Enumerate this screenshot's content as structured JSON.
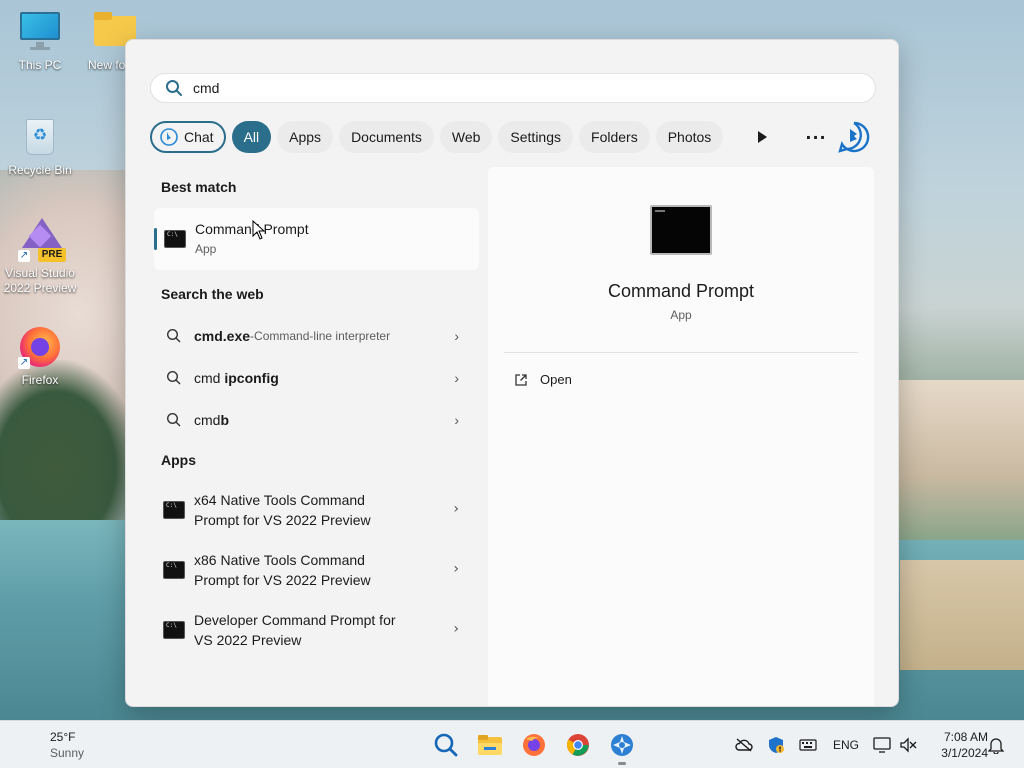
{
  "desktop": {
    "icons": [
      {
        "label": "This PC"
      },
      {
        "label": "New fo"
      },
      {
        "label": "Recycle Bin"
      },
      {
        "label": "Visual Studio 2022 Preview",
        "badge": "PRE"
      },
      {
        "label": "Firefox"
      }
    ]
  },
  "search": {
    "query": "cmd",
    "icon": "search-icon"
  },
  "filters": {
    "chat": "Chat",
    "all": "All",
    "apps": "Apps",
    "documents": "Documents",
    "web": "Web",
    "settings": "Settings",
    "folders": "Folders",
    "photos": "Photos"
  },
  "results": {
    "best_match_title": "Best match",
    "best_match": {
      "name": "Command Prompt",
      "type": "App"
    },
    "web_title": "Search the web",
    "web": [
      {
        "main": "cmd.exe",
        "sep": " - ",
        "sub": "Command-line interpreter"
      },
      {
        "prefix": "cmd ",
        "bold": "ipconfig"
      },
      {
        "prefix": "cmd",
        "bold": "b"
      }
    ],
    "apps_title": "Apps",
    "apps": [
      {
        "line1": "x64 Native Tools Command",
        "line2": "Prompt for VS 2022 Preview"
      },
      {
        "line1": "x86 Native Tools Command",
        "line2": "Prompt for VS 2022 Preview"
      },
      {
        "line1": "Developer Command Prompt for",
        "line2": "VS 2022 Preview"
      }
    ]
  },
  "preview": {
    "name": "Command Prompt",
    "type": "App",
    "action_open": "Open"
  },
  "taskbar": {
    "weather_temp": "25°F",
    "weather_cond": "Sunny",
    "lang": "ENG",
    "time": "7:08 AM",
    "date": "3/1/2024"
  },
  "colors": {
    "accent": "#2b6e8c",
    "panel_bg": "#f3f3f3"
  }
}
